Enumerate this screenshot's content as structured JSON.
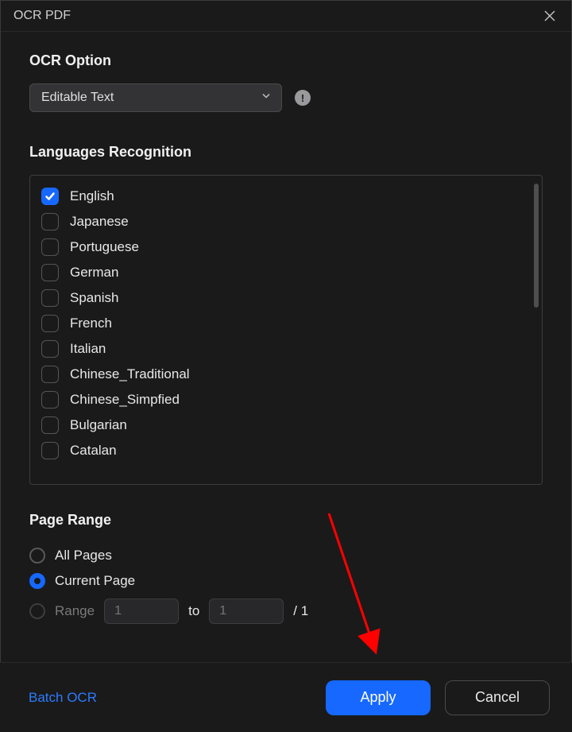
{
  "title": "OCR PDF",
  "ocr_option": {
    "label": "OCR Option",
    "selected": "Editable Text"
  },
  "languages": {
    "label": "Languages Recognition",
    "items": [
      {
        "name": "English",
        "checked": true
      },
      {
        "name": "Japanese",
        "checked": false
      },
      {
        "name": "Portuguese",
        "checked": false
      },
      {
        "name": "German",
        "checked": false
      },
      {
        "name": "Spanish",
        "checked": false
      },
      {
        "name": "French",
        "checked": false
      },
      {
        "name": "Italian",
        "checked": false
      },
      {
        "name": "Chinese_Traditional",
        "checked": false
      },
      {
        "name": "Chinese_Simpfied",
        "checked": false
      },
      {
        "name": "Bulgarian",
        "checked": false
      },
      {
        "name": "Catalan",
        "checked": false
      }
    ]
  },
  "page_range": {
    "label": "Page Range",
    "options": {
      "all": "All Pages",
      "current": "Current Page",
      "range": "Range"
    },
    "selected": "current",
    "from": "1",
    "to_sep": "to",
    "to": "1",
    "total_sep": "/ 1"
  },
  "footer": {
    "batch": "Batch OCR",
    "apply": "Apply",
    "cancel": "Cancel"
  }
}
